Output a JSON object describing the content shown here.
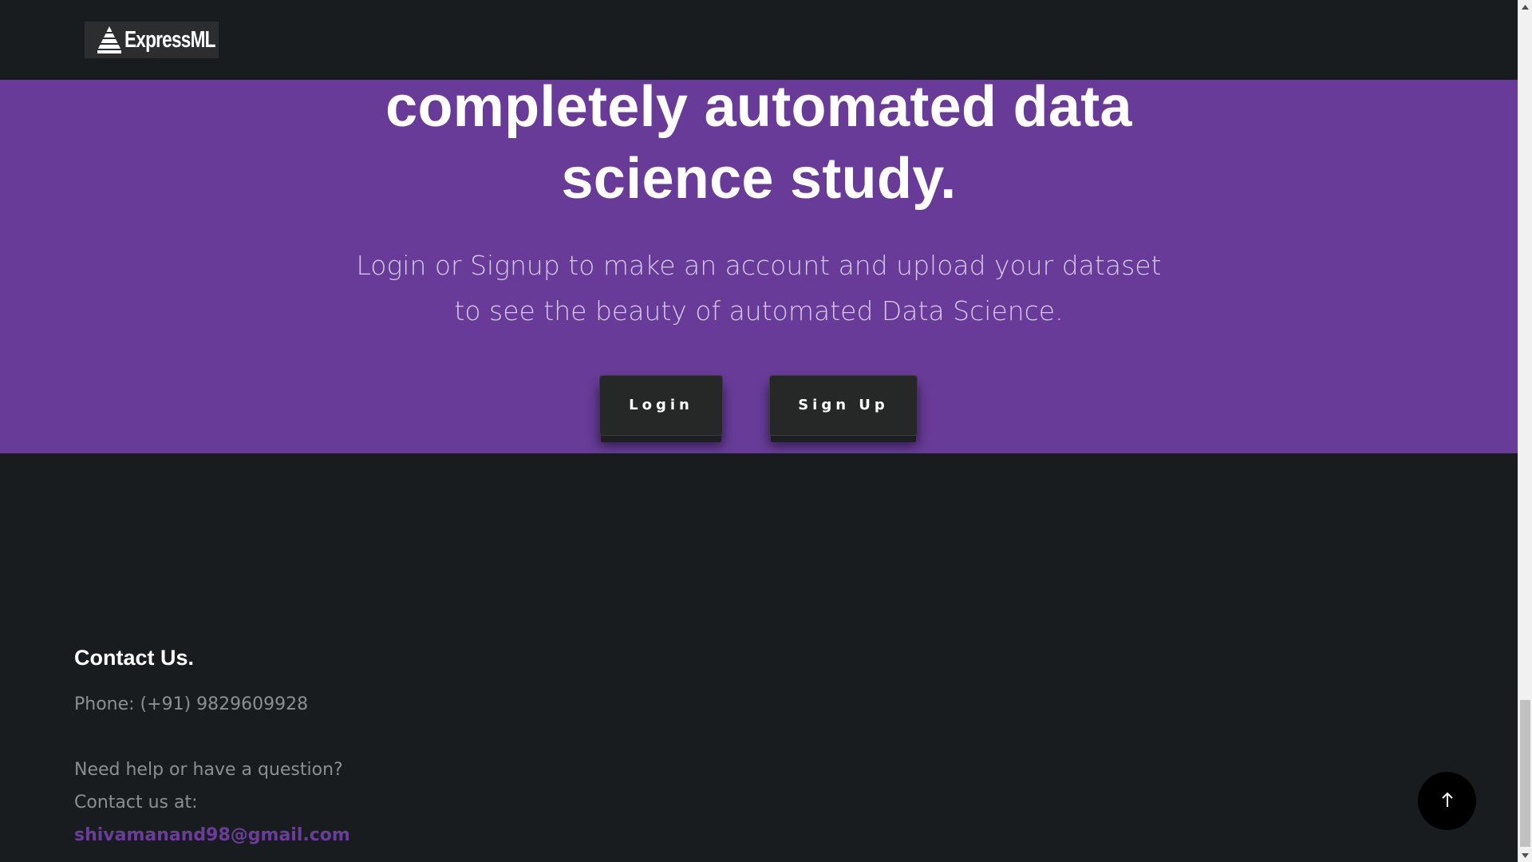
{
  "header": {
    "logo_text": "ExpressML"
  },
  "hero": {
    "title_line1": "completely automated data",
    "title_line2": "science study.",
    "subtitle_line1": "Login or Signup to make an account and upload your dataset",
    "subtitle_line2": "to see the beauty of automated Data Science.",
    "login_label": "Login",
    "signup_label": "Sign Up"
  },
  "footer": {
    "contact_title": "Contact Us.",
    "phone": "Phone: (+91) 9829609928",
    "help_text": "Need help or have a question?",
    "contact_at": "Contact us at:",
    "email": "shivamanand98@gmail.com"
  },
  "icons": {
    "logo": "pyramid-logo-icon",
    "back_to_top": "arrow-up-icon"
  },
  "colors": {
    "background": "#191c1e",
    "hero_purple": "#673b97",
    "email_link": "#6a3d9b",
    "button_dark": "#262828"
  }
}
